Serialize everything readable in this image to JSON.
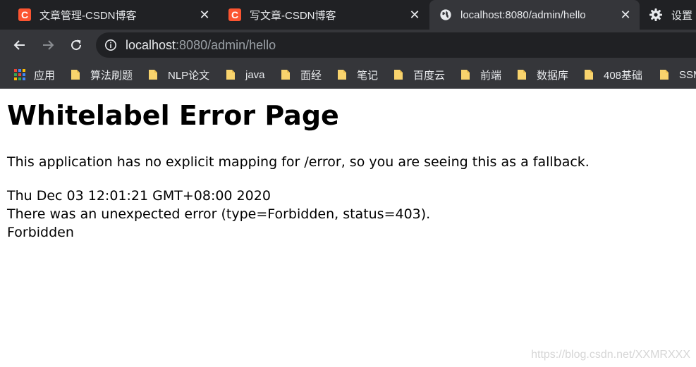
{
  "browser": {
    "tabs": [
      {
        "title": "文章管理-CSDN博客",
        "favicon": "csdn-icon",
        "active": false
      },
      {
        "title": "写文章-CSDN博客",
        "favicon": "csdn-icon",
        "active": false
      },
      {
        "title": "localhost:8080/admin/hello",
        "favicon": "globe-icon",
        "active": true
      }
    ],
    "settings_tab_label": "设置",
    "address": {
      "host": "localhost",
      "path": ":8080/admin/hello"
    },
    "bookmarks": {
      "apps_label": "应用",
      "items": [
        "算法刷题",
        "NLP论文",
        "java",
        "面经",
        "笔记",
        "百度云",
        "前端",
        "数据库",
        "408基础",
        "SSM"
      ]
    },
    "colors": {
      "csdn_brand": "#fc5531",
      "folder": "#f8d36d",
      "tabstrip": "#202124",
      "toolbar": "#35363a"
    }
  },
  "page": {
    "heading": "Whitelabel Error Page",
    "description": "This application has no explicit mapping for /error, so you are seeing this as a fallback.",
    "timestamp": "Thu Dec 03 12:01:21 GMT+08:00 2020",
    "error_line": "There was an unexpected error (type=Forbidden, status=403).",
    "error_message": "Forbidden"
  },
  "watermark": "https://blog.csdn.net/XXMRXXX"
}
